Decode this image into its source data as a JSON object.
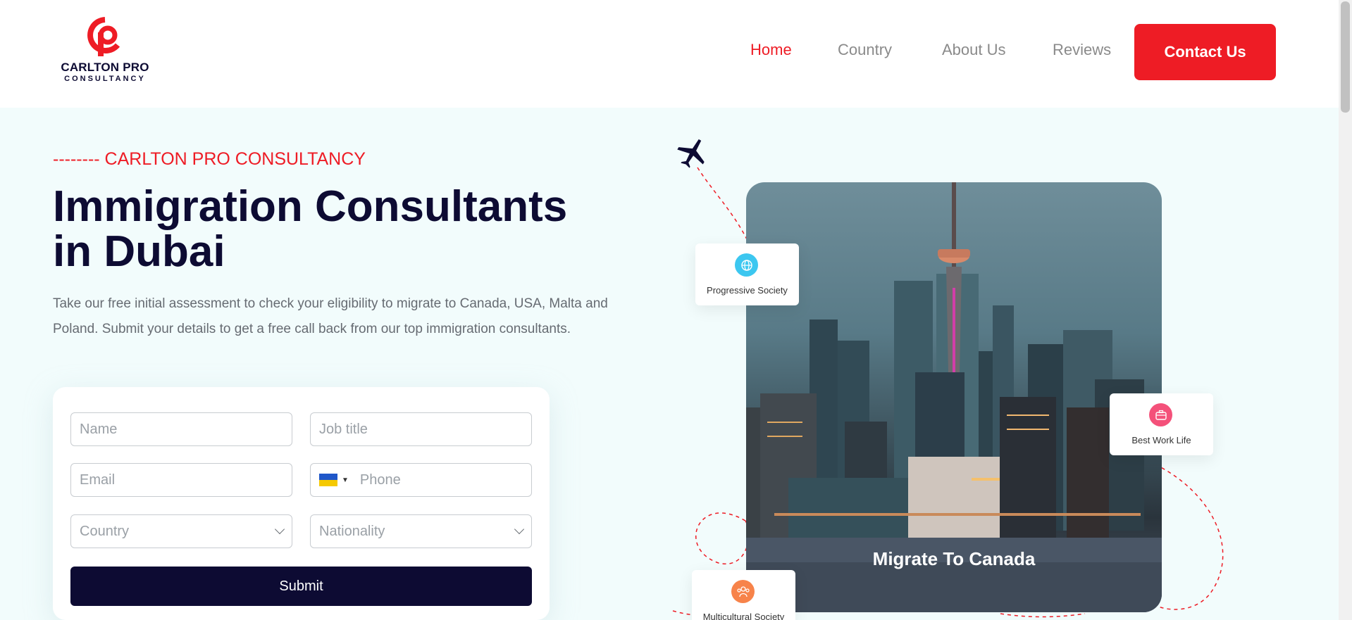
{
  "header": {
    "logo": {
      "line1": "CARLTON PRO",
      "line2": "CONSULTANCY"
    },
    "nav": [
      {
        "label": "Home",
        "active": true
      },
      {
        "label": "Country",
        "active": false
      },
      {
        "label": "About Us",
        "active": false
      },
      {
        "label": "Reviews",
        "active": false
      }
    ],
    "contact_label": "Contact Us"
  },
  "hero": {
    "eyebrow": "-------- CARLTON PRO CONSULTANCY",
    "headline_line1": "Immigration Consultants",
    "headline_line2": "in Dubai",
    "description": "Take our free initial assessment to check your eligibility to migrate to Canada, USA, Malta and Poland. Submit your details to get a free call back from our top immigration consultants."
  },
  "form": {
    "name_placeholder": "Name",
    "job_placeholder": "Job title",
    "email_placeholder": "Email",
    "phone_placeholder": "Phone",
    "country_select": "Country",
    "nationality_select": "Nationality",
    "submit_label": "Submit"
  },
  "feature_card": {
    "caption": "Migrate To Canada",
    "badges": [
      {
        "label": "Progressive Society",
        "icon": "globe-icon",
        "color": "#3cc7f0"
      },
      {
        "label": "Best Work Life",
        "icon": "briefcase-icon",
        "color": "#f4517a"
      },
      {
        "label": "Multicultural Society",
        "icon": "people-icon",
        "color": "#f7834a"
      }
    ]
  },
  "colors": {
    "accent": "#ee1c25",
    "navy": "#0d0b33",
    "background": "#f2fcfc"
  }
}
